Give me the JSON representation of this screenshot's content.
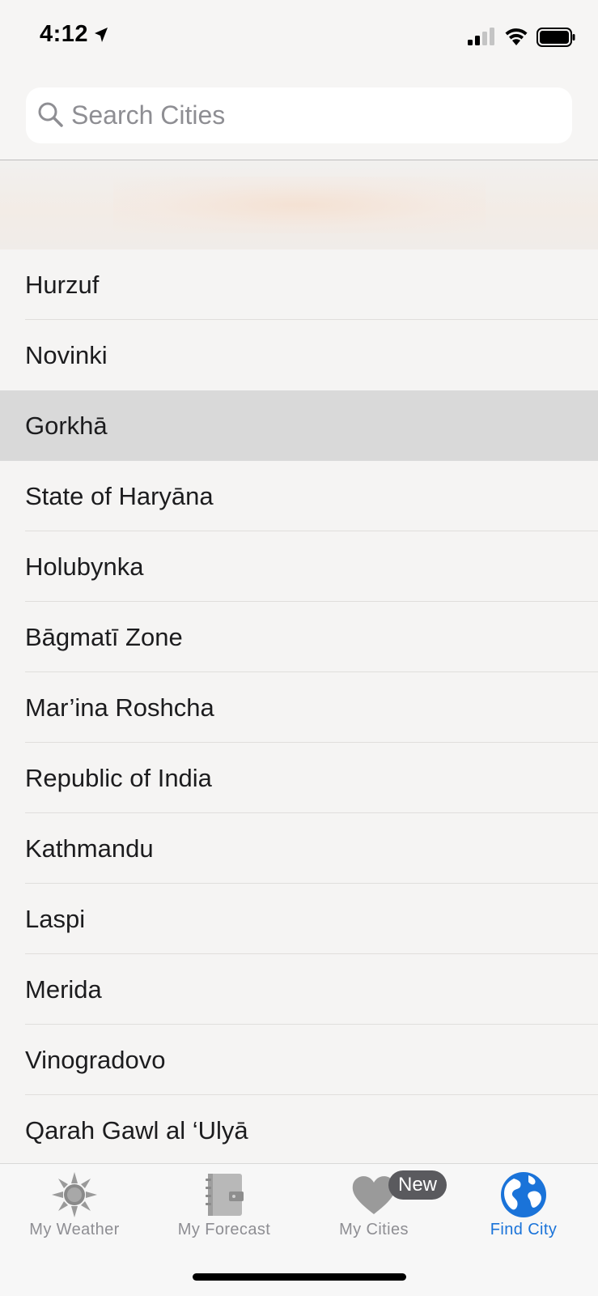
{
  "status_bar": {
    "time": "4:12"
  },
  "search": {
    "placeholder": "Search Cities",
    "value": ""
  },
  "cities": [
    {
      "name": "Hurzuf",
      "selected": false
    },
    {
      "name": "Novinki",
      "selected": false
    },
    {
      "name": "Gorkhā",
      "selected": true
    },
    {
      "name": "State of Haryāna",
      "selected": false
    },
    {
      "name": "Holubynka",
      "selected": false
    },
    {
      "name": "Bāgmatī Zone",
      "selected": false
    },
    {
      "name": "Mar’ina Roshcha",
      "selected": false
    },
    {
      "name": "Republic of India",
      "selected": false
    },
    {
      "name": "Kathmandu",
      "selected": false
    },
    {
      "name": "Laspi",
      "selected": false
    },
    {
      "name": "Merida",
      "selected": false
    },
    {
      "name": "Vinogradovo",
      "selected": false
    },
    {
      "name": "Qarah Gawl al ‘Ulyā",
      "selected": false
    }
  ],
  "tabs": [
    {
      "label": "My Weather",
      "icon": "sun-icon",
      "active": false
    },
    {
      "label": "My Forecast",
      "icon": "notebook-icon",
      "active": false
    },
    {
      "label": "My Cities",
      "icon": "heart-icon",
      "active": false,
      "badge": "New"
    },
    {
      "label": "Find City",
      "icon": "globe-icon",
      "active": true
    }
  ],
  "colors": {
    "accent": "#1a73d9",
    "inactive_tab": "#8e8e93",
    "selected_row": "#d9d9d9",
    "badge": "#5a5a5e"
  }
}
